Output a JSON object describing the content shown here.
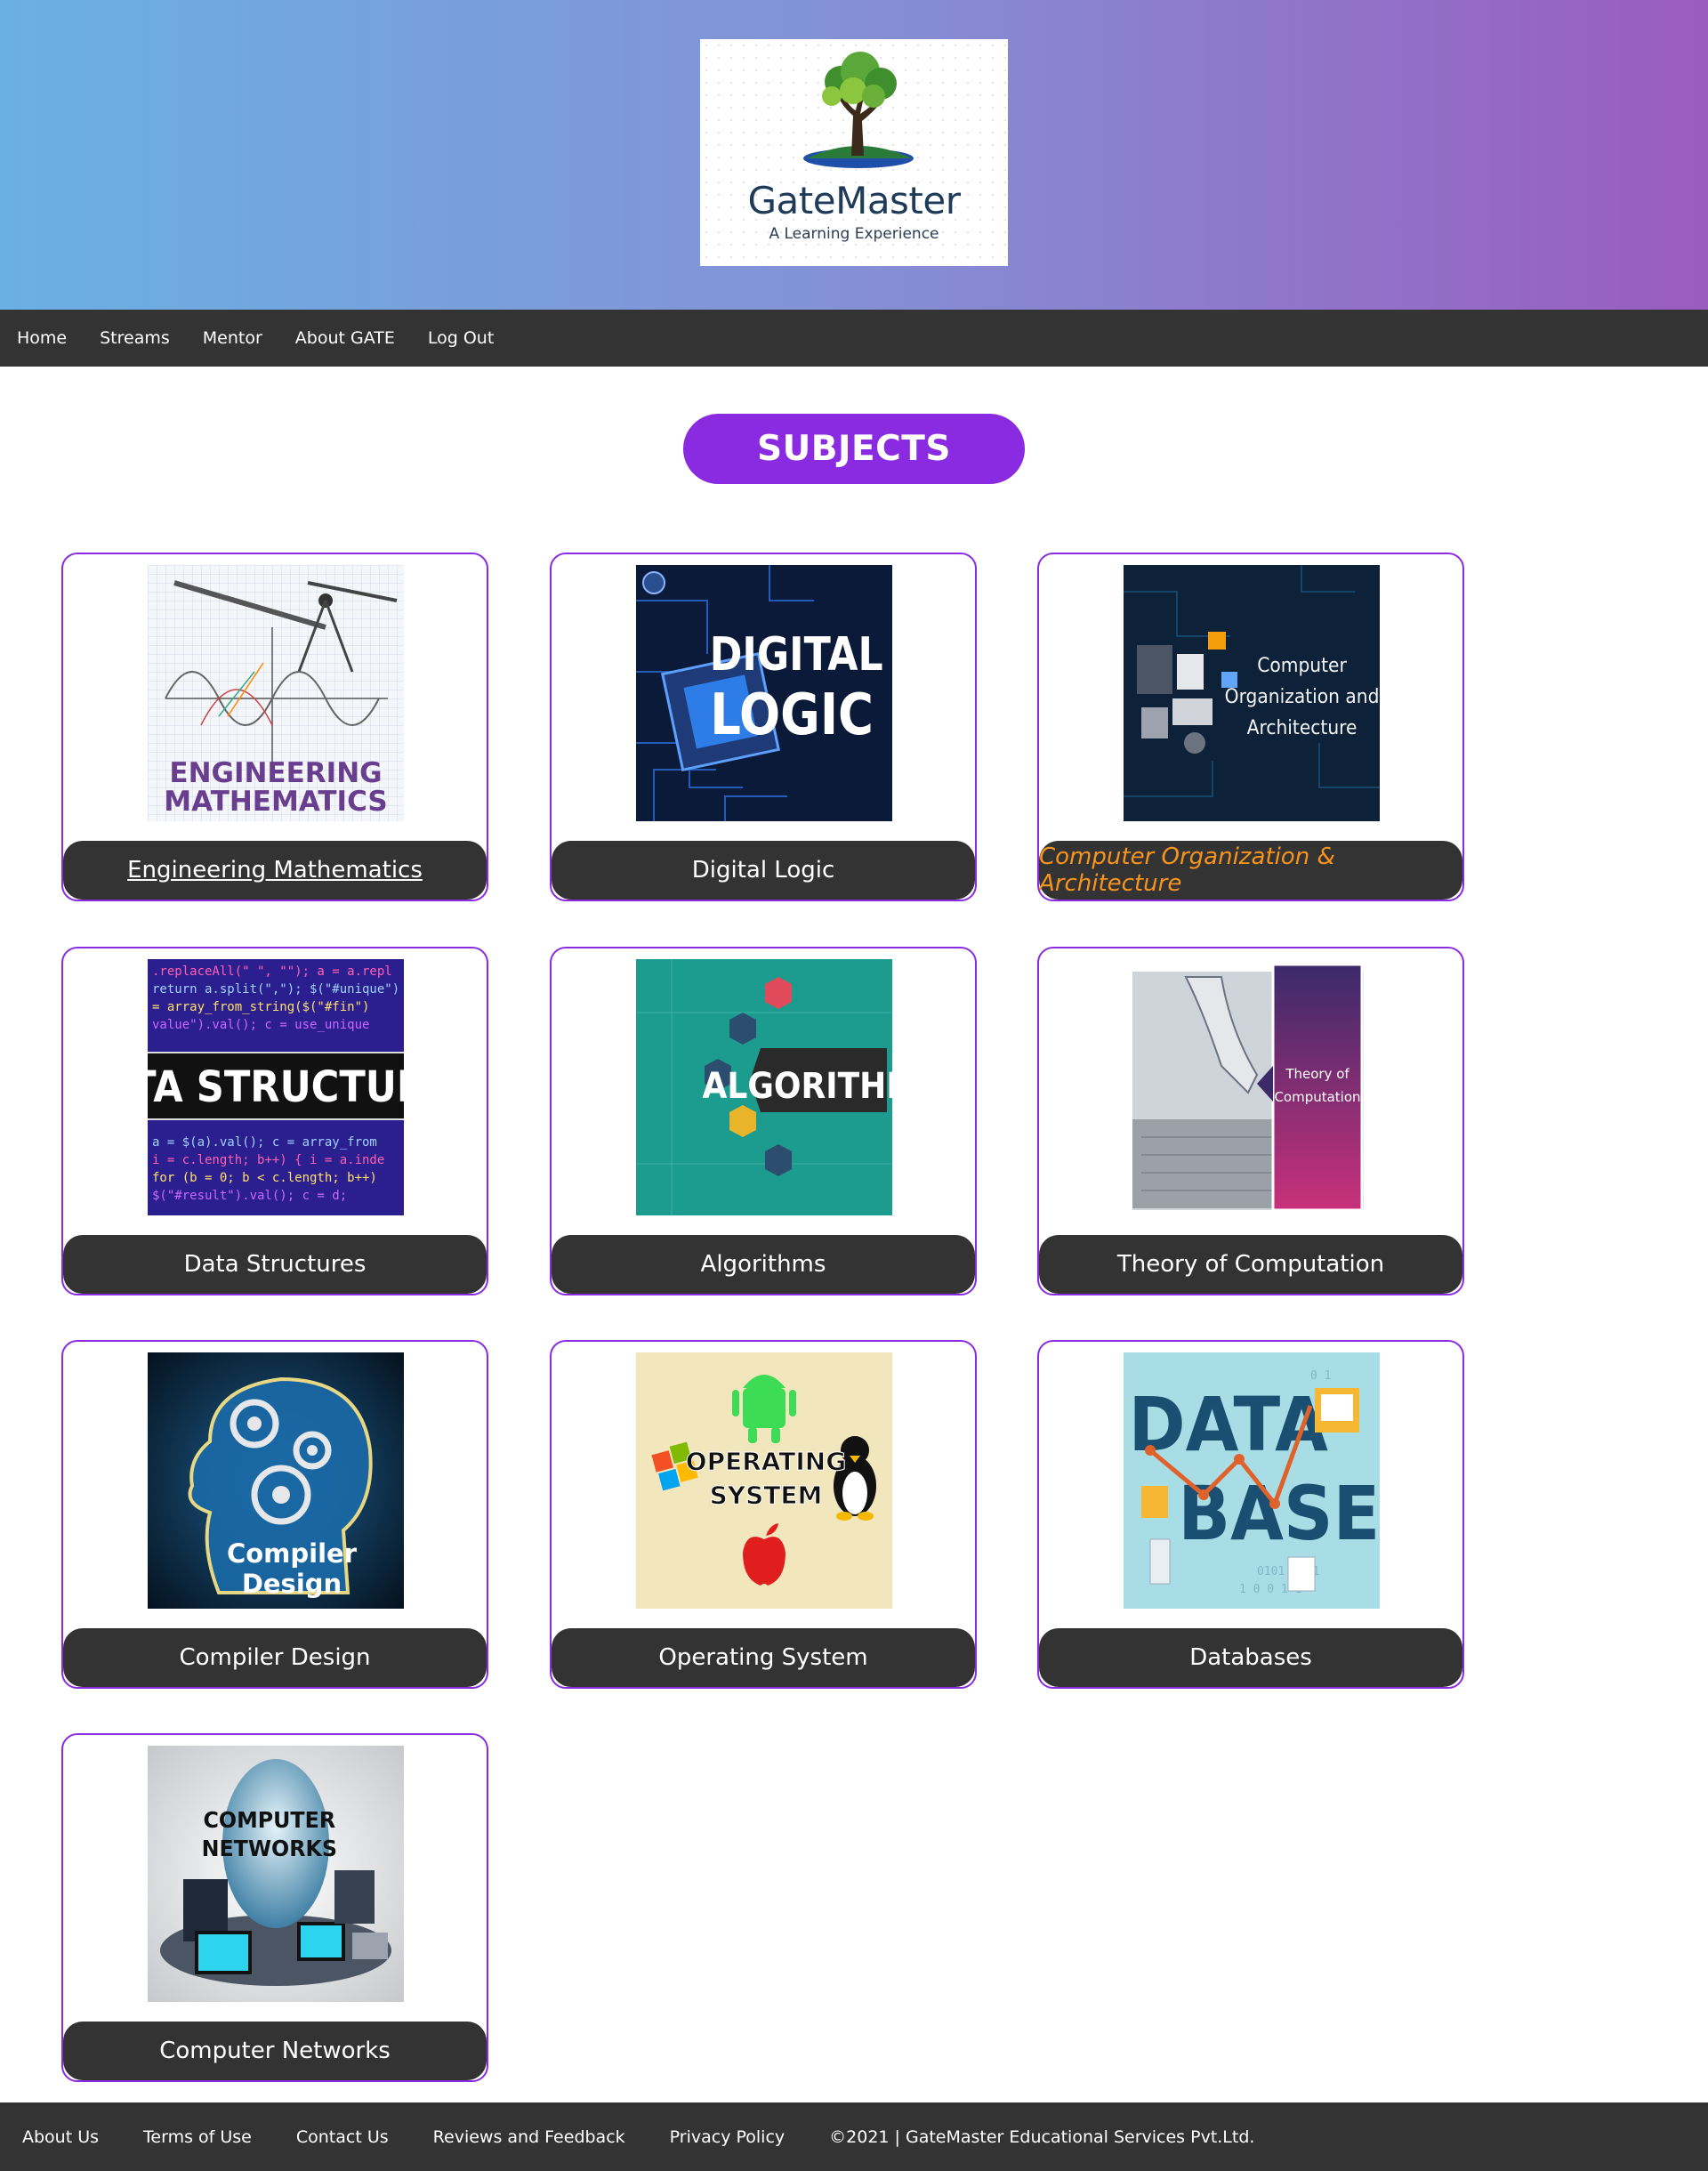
{
  "header": {
    "logo": {
      "name": "GateMaster",
      "tagline": "A Learning Experience"
    }
  },
  "nav": {
    "items": [
      "Home",
      "Streams",
      "Mentor",
      "About GATE",
      "Log Out"
    ]
  },
  "main": {
    "heading": "SUBJECTS",
    "subjects": [
      {
        "label": "Engineering Mathematics",
        "image_text": [
          "ENGINEERING",
          "MATHEMATICS"
        ],
        "state": "underlined"
      },
      {
        "label": "Digital Logic",
        "image_text": [
          "DIGITAL",
          "LOGIC"
        ],
        "state": "normal"
      },
      {
        "label": "Computer Organization & Architecture",
        "image_text": [
          "Computer",
          "Organization and",
          "Architecture"
        ],
        "state": "hover"
      },
      {
        "label": "Data Structures",
        "image_text": [
          "DATA STRUCTURES"
        ],
        "state": "normal"
      },
      {
        "label": "Algorithms",
        "image_text": [
          "ALGORITHMS"
        ],
        "state": "normal"
      },
      {
        "label": "Theory of Computation",
        "image_text": [
          "Theory of",
          "Computation"
        ],
        "state": "normal"
      },
      {
        "label": "Compiler Design",
        "image_text": [
          "Compiler",
          "Design"
        ],
        "state": "normal"
      },
      {
        "label": "Operating System",
        "image_text": [
          "OPERATING",
          "SYSTEM"
        ],
        "state": "normal"
      },
      {
        "label": "Databases",
        "image_text": [
          "DATA",
          "BASE"
        ],
        "state": "normal"
      },
      {
        "label": "Computer Networks",
        "image_text": [
          "COMPUTER",
          "NETWORKS"
        ],
        "state": "normal"
      }
    ]
  },
  "footer": {
    "links": [
      "About Us",
      "Terms of Use",
      "Contact Us",
      "Reviews and Feedback",
      "Privacy Policy"
    ],
    "copyright": "©2021 | GateMaster Educational Services Pvt.Ltd."
  },
  "colors": {
    "accent": "#8a2be2",
    "dark_bar": "#333333",
    "hover_label": "#f7941d",
    "banner_start": "#6ab0e4",
    "banner_end": "#9a5cbf"
  }
}
